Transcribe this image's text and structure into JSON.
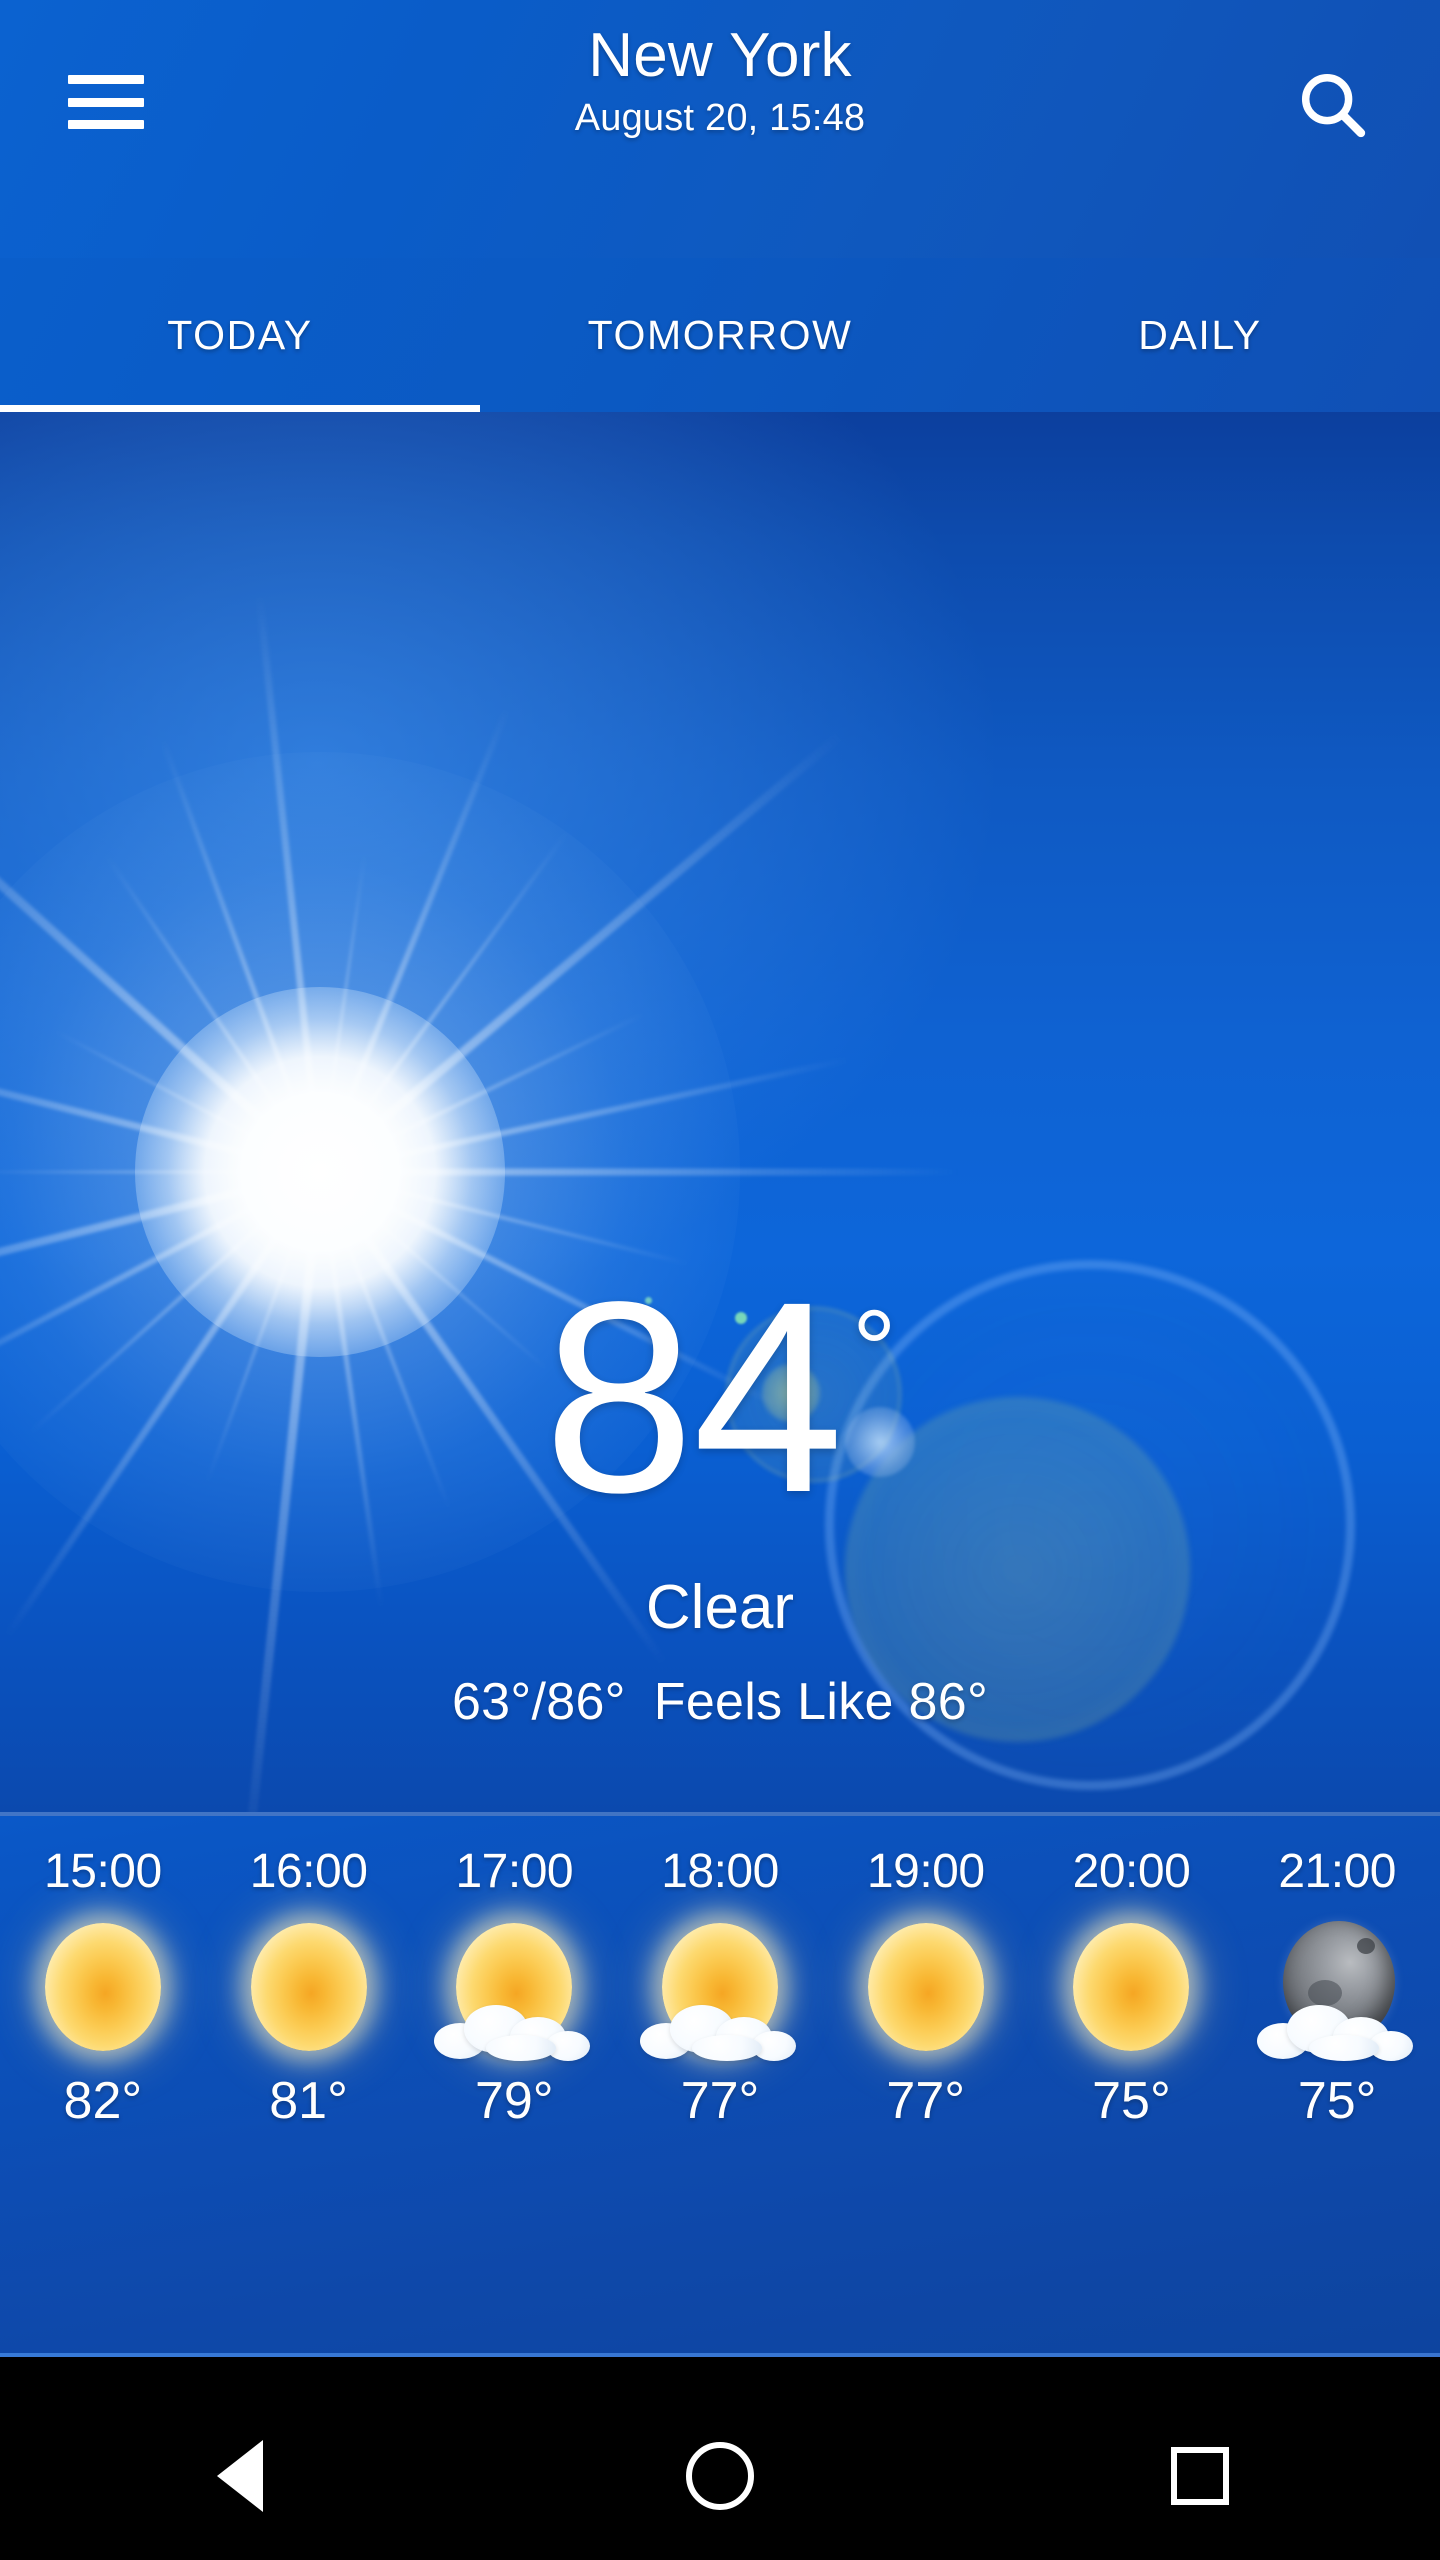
{
  "appbar": {
    "title": "New York",
    "subtitle": "August 20, 15:48",
    "menu_icon": "hamburger-menu-icon",
    "search_icon": "search-icon"
  },
  "tabs": [
    {
      "label": "TODAY",
      "active": true
    },
    {
      "label": "TOMORROW",
      "active": false
    },
    {
      "label": "DAILY",
      "active": false
    }
  ],
  "current": {
    "temperature": "84",
    "degree_symbol": "°",
    "condition": "Clear",
    "low_high": "63°/86°",
    "feels_like": "Feels Like 86°",
    "sky_icon": "sun-icon"
  },
  "hourly": [
    {
      "time": "15:00",
      "temp": "82°",
      "icon": "sun-icon"
    },
    {
      "time": "16:00",
      "temp": "81°",
      "icon": "sun-icon"
    },
    {
      "time": "17:00",
      "temp": "79°",
      "icon": "sun-cloud-icon"
    },
    {
      "time": "18:00",
      "temp": "77°",
      "icon": "sun-cloud-icon"
    },
    {
      "time": "19:00",
      "temp": "77°",
      "icon": "sun-icon"
    },
    {
      "time": "20:00",
      "temp": "75°",
      "icon": "sun-icon"
    },
    {
      "time": "21:00",
      "temp": "75°",
      "icon": "moon-cloud-icon"
    }
  ],
  "navbar": {
    "back_label": "Back",
    "home_label": "Home",
    "recents_label": "Recents"
  },
  "colors": {
    "accent": "#0a5ecb",
    "sky_top": "#0c3f9e",
    "sky_mid": "#0d66da",
    "hourly_bg": "#0b52bd",
    "navbar_bg": "#000000",
    "text": "#ffffff"
  }
}
